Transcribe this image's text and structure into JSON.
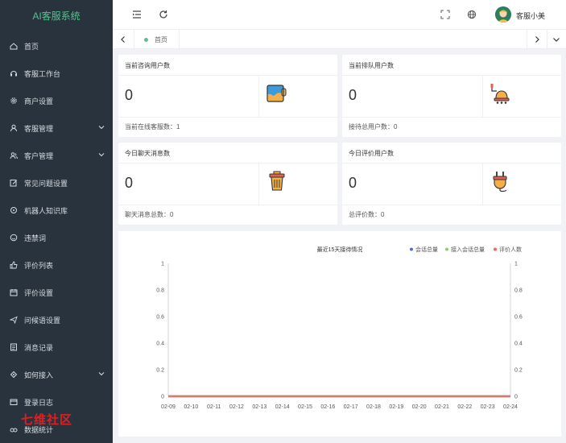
{
  "app": {
    "title": "AI客服系统"
  },
  "sidebar": {
    "items": [
      {
        "label": "首页",
        "icon": "home-icon"
      },
      {
        "label": "客服工作台",
        "icon": "headset-icon"
      },
      {
        "label": "商户设置",
        "icon": "gear-icon"
      },
      {
        "label": "客服管理",
        "icon": "user-icon",
        "expandable": true
      },
      {
        "label": "客户管理",
        "icon": "users-icon",
        "expandable": true
      },
      {
        "label": "常见问题设置",
        "icon": "edit-icon"
      },
      {
        "label": "机器人知识库",
        "icon": "robot-icon"
      },
      {
        "label": "违禁词",
        "icon": "smile-icon"
      },
      {
        "label": "评价列表",
        "icon": "thumb-up-icon"
      },
      {
        "label": "评价设置",
        "icon": "calendar-icon"
      },
      {
        "label": "问候语设置",
        "icon": "send-icon"
      },
      {
        "label": "消息记录",
        "icon": "document-icon"
      },
      {
        "label": "如何接入",
        "icon": "link-icon",
        "expandable": true
      },
      {
        "label": "登录日志",
        "icon": "log-icon"
      },
      {
        "label": "数据统计",
        "icon": "stats-icon"
      }
    ]
  },
  "watermark": "七维社区",
  "header": {
    "username": "客服小美"
  },
  "tabs": [
    {
      "label": "首页"
    }
  ],
  "cards": [
    {
      "title": "当前咨询用户数",
      "value": "0",
      "footer": "当前在线客服数：1",
      "icon": "paint-bucket-icon"
    },
    {
      "title": "当前排队用户数",
      "value": "0",
      "footer": "接待总用户数：0",
      "icon": "bell-icon"
    },
    {
      "title": "今日聊天消息数",
      "value": "0",
      "footer": "聊天消息总数：0",
      "icon": "trash-can-icon"
    },
    {
      "title": "今日评价用户数",
      "value": "0",
      "footer": "总评价数：0",
      "icon": "plug-icon"
    }
  ],
  "colors": {
    "accent": "#58c18d",
    "sidebar": "#28333e",
    "series1": "#5470c6",
    "series2": "#91cc75",
    "series3": "#ee6666"
  },
  "chart_data": {
    "type": "line",
    "title": "最近15天接待情况",
    "x": [
      "02-09",
      "02-10",
      "02-11",
      "02-12",
      "02-13",
      "02-14",
      "02-15",
      "02-16",
      "02-17",
      "02-18",
      "02-19",
      "02-20",
      "02-21",
      "02-22",
      "02-23",
      "02-24"
    ],
    "yticks": [
      "0",
      "0.2",
      "0.4",
      "0.6",
      "0.8",
      "1"
    ],
    "ylim": [
      0,
      1
    ],
    "series": [
      {
        "name": "会话总量",
        "values": [
          0,
          0,
          0,
          0,
          0,
          0,
          0,
          0,
          0,
          0,
          0,
          0,
          0,
          0,
          0,
          0
        ]
      },
      {
        "name": "接入会话总量",
        "values": [
          0,
          0,
          0,
          0,
          0,
          0,
          0,
          0,
          0,
          0,
          0,
          0,
          0,
          0,
          0,
          0
        ]
      },
      {
        "name": "评价人数",
        "values": [
          0,
          0,
          0,
          0,
          0,
          0,
          0,
          0,
          0,
          0,
          0,
          0,
          0,
          0,
          0,
          0
        ]
      }
    ],
    "legend": "top-right"
  }
}
